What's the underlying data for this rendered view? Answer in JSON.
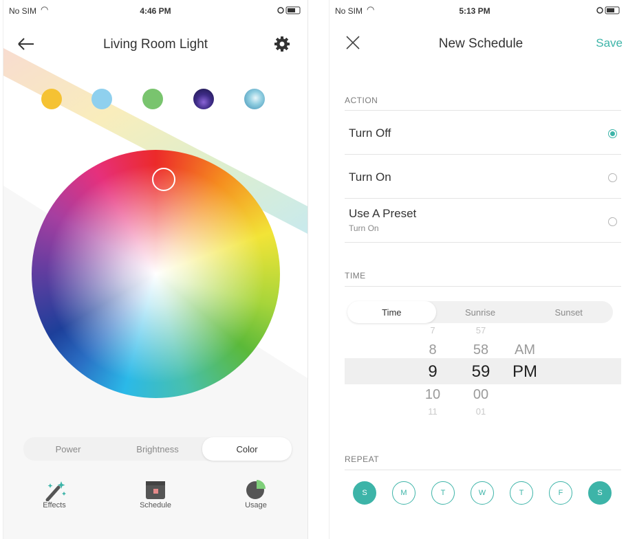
{
  "left": {
    "status": {
      "carrier": "No SIM",
      "time": "4:46 PM"
    },
    "title": "Living Room Light",
    "tabs": [
      "Power",
      "Brightness",
      "Color"
    ],
    "active_tab": "Color",
    "tools": {
      "effects": "Effects",
      "schedule": "Schedule",
      "usage": "Usage"
    },
    "presets": [
      "#f5c233",
      "#8fd0ee",
      "#79c46e",
      "night-sky",
      "ocean"
    ]
  },
  "right": {
    "status": {
      "carrier": "No SIM",
      "time": "5:13 PM"
    },
    "title": "New Schedule",
    "save": "Save",
    "action_label": "ACTION",
    "actions": [
      {
        "label": "Turn Off",
        "selected": true
      },
      {
        "label": "Turn On",
        "selected": false
      },
      {
        "label": "Use A Preset",
        "sub": "Turn On",
        "selected": false
      }
    ],
    "time_label": "TIME",
    "time_tabs": [
      "Time",
      "Sunrise",
      "Sunset"
    ],
    "picker": {
      "hours": [
        "7",
        "8",
        "9",
        "10",
        "11"
      ],
      "minutes": [
        "57",
        "58",
        "59",
        "00",
        "01"
      ],
      "ampm": [
        "AM",
        "PM"
      ],
      "selected": {
        "hour": "9",
        "minute": "59",
        "ampm": "PM"
      }
    },
    "repeat_label": "REPEAT",
    "days": [
      {
        "label": "S",
        "on": true
      },
      {
        "label": "M",
        "on": false
      },
      {
        "label": "T",
        "on": false
      },
      {
        "label": "W",
        "on": false
      },
      {
        "label": "T",
        "on": false
      },
      {
        "label": "F",
        "on": false
      },
      {
        "label": "S",
        "on": true
      }
    ],
    "accent": "#3db4a8"
  }
}
